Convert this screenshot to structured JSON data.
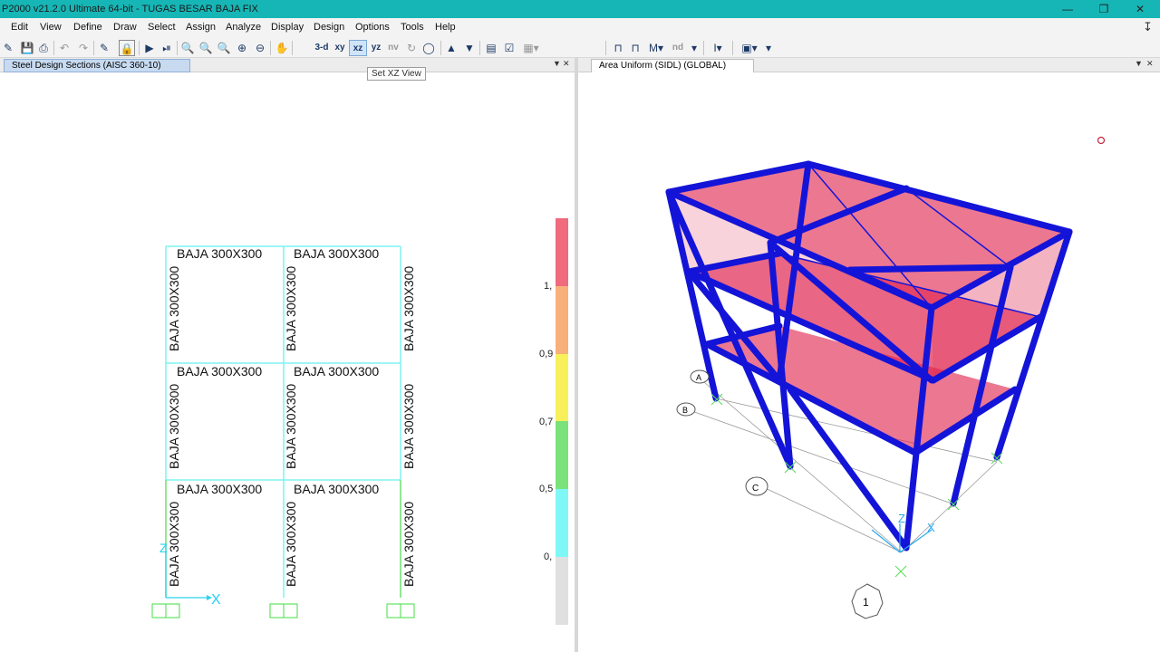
{
  "window": {
    "title": "P2000 v21.2.0 Ultimate 64-bit - TUGAS BESAR BAJA FIX",
    "minimize_icon": "minimize-icon",
    "restore_icon": "restore-icon",
    "close_icon": "close-icon"
  },
  "menu": {
    "items": [
      "Edit",
      "View",
      "Define",
      "Draw",
      "Select",
      "Assign",
      "Analyze",
      "Display",
      "Design",
      "Options",
      "Tools",
      "Help"
    ]
  },
  "toolbar": {
    "view_3d": "3-d",
    "view_xy": "xy",
    "view_xz": "xz",
    "view_yz": "yz",
    "view_nv": "nv",
    "nd": "nd",
    "tooltip": "Set XZ View"
  },
  "left_panel": {
    "tab_title": "Steel Design Sections  (AISC 360-10)",
    "beam_label": "BAJA 300X300",
    "column_label": "BAJA 300X300",
    "axis_x": "X",
    "axis_z": "Z",
    "legend": {
      "labels": [
        "1,",
        "0,9",
        "0,7",
        "0,5",
        "0,"
      ],
      "colors": [
        "#f06b7e",
        "#f8b07a",
        "#f7f05a",
        "#7be27b",
        "#7ff7f7",
        "#e0e0e0"
      ]
    }
  },
  "right_panel": {
    "tab_title": "Area Uniform (SIDL) (GLOBAL)",
    "grid_bubbles": [
      "A",
      "B",
      "C",
      "1"
    ],
    "axis_x": "X",
    "axis_z": "Z",
    "frame_color": "#1414d8",
    "slab_color": "#e0244e"
  }
}
